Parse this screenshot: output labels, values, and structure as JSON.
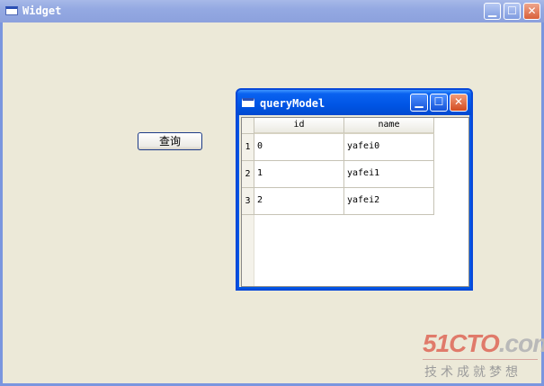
{
  "main_window": {
    "title": "Widget",
    "buttons": {
      "minimize": "▁",
      "maximize": "☐",
      "close": "✕"
    }
  },
  "query_button": {
    "label": "查询"
  },
  "model_window": {
    "title": "queryModel",
    "buttons": {
      "minimize": "▁",
      "maximize": "☐",
      "close": "✕"
    },
    "table": {
      "columns": [
        "id",
        "name"
      ],
      "rows": [
        {
          "header": "1",
          "cells": [
            "0",
            "yafei0"
          ]
        },
        {
          "header": "2",
          "cells": [
            "1",
            "yafei1"
          ]
        },
        {
          "header": "3",
          "cells": [
            "2",
            "yafei2"
          ]
        }
      ]
    }
  },
  "watermark": {
    "logo_red": "51CTO",
    "logo_gray": ".com",
    "tagline": "技术成就梦想"
  },
  "colors": {
    "desktop": "#ECE9D8",
    "active_title": "#0055E5",
    "inactive_title": "#94A9E2"
  }
}
